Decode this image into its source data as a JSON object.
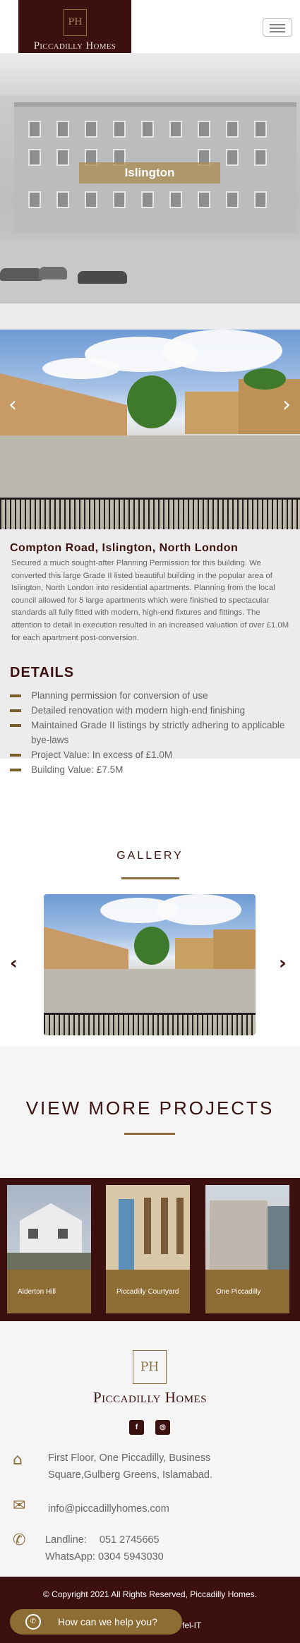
{
  "brand": {
    "monogram": "PH",
    "name": "Piccadilly Homes",
    "colors": {
      "maroon": "#3d1010",
      "gold": "#8d6d33",
      "light_gray": "#ececec"
    }
  },
  "header": {
    "menu_icon": "hamburger-icon"
  },
  "hero": {
    "location": "Islington"
  },
  "project": {
    "slider_prev_icon": "chevron-left-icon",
    "slider_next_icon": "chevron-right-icon",
    "title": "Compton Road, Islington, North London",
    "description": "Secured a much sought-after Planning Permission for this building. We converted this large Grade II listed beautiful building in the popular area of Islington, North London into residential apartments. Planning from the local council allowed for 5 large apartments which were finished to spectacular standards all fully fitted with modern, high-end fixtures and fittings. The attention to detail in execution resulted in an increased valuation of over £1.0M for each apartment post-conversion.",
    "details_heading": "DETAILS",
    "details": [
      "Planning permission for conversion of use",
      "Detailed renovation with modern high-end finishing",
      "Maintained Grade II listings by strictly adhering to applicable bye-laws",
      "Project Value: In excess of £1.0M",
      "Building Value: £7.5M"
    ]
  },
  "gallery": {
    "heading": "GALLERY",
    "prev_icon": "chevron-left-icon",
    "next_icon": "chevron-right-icon"
  },
  "more_projects": {
    "heading": "VIEW MORE PROJECTS",
    "cards": [
      {
        "label": "Alderton Hill"
      },
      {
        "label": "Piccadilly Courtyard"
      },
      {
        "label": "One Piccadilly"
      }
    ]
  },
  "footer": {
    "monogram": "PH",
    "name": "Piccadilly Homes",
    "social": [
      {
        "icon": "facebook-icon",
        "glyph": "f"
      },
      {
        "icon": "instagram-icon",
        "glyph": "◎"
      }
    ],
    "address_icon": "home-icon",
    "address": "First Floor, One Piccadilly, Business Square,Gulberg Greens, Islamabad.",
    "email_icon": "envelope-icon",
    "email": "info@piccadillyhomes.com",
    "phone_icon": "phone-icon",
    "landline_label": "Landline:",
    "landline": "051 2745665",
    "whatsapp": "WhatsApp: 0304 5943030"
  },
  "copyright": {
    "text": "© Copyright 2021 All Rights Reserved, Piccadilly Homes.",
    "credit": "fel-IT"
  },
  "chat": {
    "icon": "whatsapp-icon",
    "label": "How can we help you?"
  }
}
